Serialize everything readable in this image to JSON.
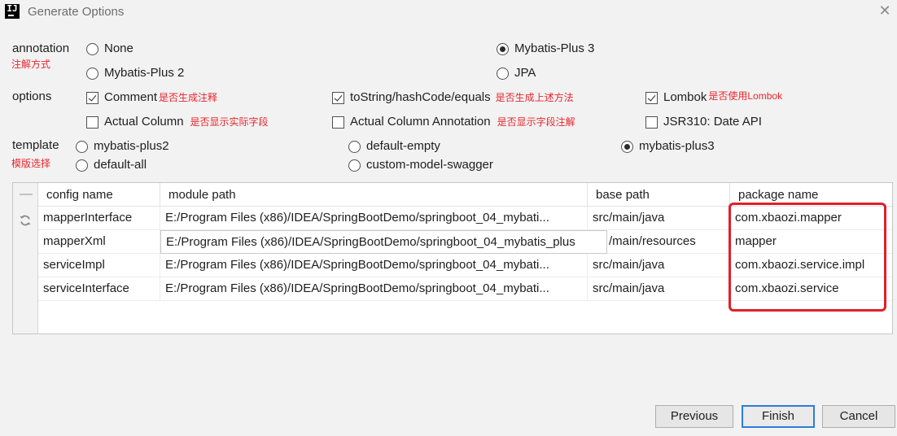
{
  "window": {
    "icon_text": "IJ",
    "title": "Generate Options",
    "close_glyph": "✕"
  },
  "annotation": {
    "label": "annotation",
    "note": "注解方式",
    "options": [
      {
        "label": "None",
        "selected": false
      },
      {
        "label": "Mybatis-Plus 3",
        "selected": true
      },
      {
        "label": "Mybatis-Plus 2",
        "selected": false
      },
      {
        "label": "JPA",
        "selected": false
      }
    ]
  },
  "options": {
    "label": "options",
    "items": [
      {
        "label": "Comment",
        "checked": true,
        "note": "是否生成注释"
      },
      {
        "label": "toString/hashCode/equals",
        "checked": true,
        "note": "是否生成上述方法"
      },
      {
        "label": "Lombok",
        "checked": true,
        "note": "是否使用Lombok"
      },
      {
        "label": "Actual Column",
        "checked": false,
        "note": "是否显示实际字段"
      },
      {
        "label": "Actual Column Annotation",
        "checked": false,
        "note": "是否显示字段注解"
      },
      {
        "label": "JSR310: Date API",
        "checked": false,
        "note": ""
      }
    ]
  },
  "template": {
    "label": "template",
    "note": "模版选择",
    "options": [
      {
        "label": "mybatis-plus2",
        "selected": false
      },
      {
        "label": "default-empty",
        "selected": false
      },
      {
        "label": "mybatis-plus3",
        "selected": true
      },
      {
        "label": "default-all",
        "selected": false
      },
      {
        "label": "custom-model-swagger",
        "selected": false
      }
    ]
  },
  "table": {
    "minus_glyph": "—",
    "refresh_icon": "refresh-icon",
    "columns": [
      "config name",
      "module path",
      "base path",
      "package name"
    ],
    "rows": [
      {
        "config_name": "mapperInterface",
        "module_path": "E:/Program Files (x86)/IDEA/SpringBootDemo/springboot_04_mybati...",
        "base_path": "src/main/java",
        "package_name": "com.xbaozi.mapper"
      },
      {
        "config_name": "mapperXml",
        "module_path": "E:/Program Files (x86)/IDEA/SpringBootDemo/springboot_04_mybatis_plus",
        "base_path": "/main/resources",
        "package_name": "mapper"
      },
      {
        "config_name": "serviceImpl",
        "module_path": "E:/Program Files (x86)/IDEA/SpringBootDemo/springboot_04_mybati...",
        "base_path": "src/main/java",
        "package_name": "com.xbaozi.service.impl"
      },
      {
        "config_name": "serviceInterface",
        "module_path": "E:/Program Files (x86)/IDEA/SpringBootDemo/springboot_04_mybati...",
        "base_path": "src/main/java",
        "package_name": "com.xbaozi.service"
      }
    ]
  },
  "buttons": {
    "previous": "Previous",
    "finish": "Finish",
    "cancel": "Cancel"
  },
  "colors": {
    "note_red": "#e8262d",
    "highlight_box": "#e0202a",
    "default_button_border": "#2f7bd8"
  }
}
